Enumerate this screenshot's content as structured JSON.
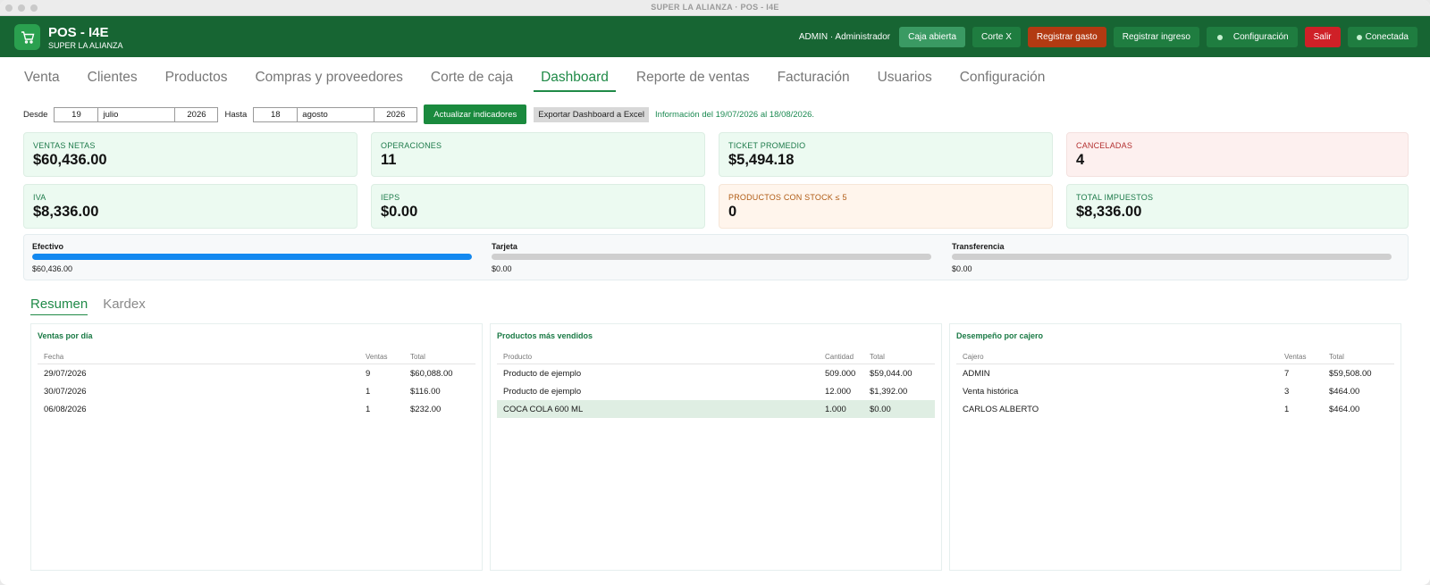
{
  "window": {
    "title": "SUPER LA ALIANZA · POS - I4E"
  },
  "header": {
    "app_title": "POS - I4E",
    "store_name": "SUPER LA ALIANZA",
    "user": "ADMIN · Administrador",
    "buttons": {
      "caja_abierta": "Caja abierta",
      "corte_x": "Corte X",
      "registrar_gasto": "Registrar gasto",
      "registrar_ingreso": "Registrar ingreso",
      "configuracion": "Configuración",
      "salir": "Salir",
      "conectada": "Conectada"
    }
  },
  "nav": {
    "tabs": [
      "Venta",
      "Clientes",
      "Productos",
      "Compras y proveedores",
      "Corte de caja",
      "Dashboard",
      "Reporte de ventas",
      "Facturación",
      "Usuarios",
      "Configuración"
    ],
    "active": "Dashboard"
  },
  "filters": {
    "desde_label": "Desde",
    "desde": {
      "day": "19",
      "month": "julio",
      "year": "2026"
    },
    "hasta_label": "Hasta",
    "hasta": {
      "day": "18",
      "month": "agosto",
      "year": "2026"
    },
    "update_button": "Actualizar indicadores",
    "export_button": "Exportar Dashboard a Excel",
    "info": "Información del 19/07/2026 al 18/08/2026."
  },
  "cards": [
    {
      "label": "VENTAS NETAS",
      "value": "$60,436.00"
    },
    {
      "label": "OPERACIONES",
      "value": "11"
    },
    {
      "label": "TICKET PROMEDIO",
      "value": "$5,494.18"
    },
    {
      "label": "CANCELADAS",
      "value": "4"
    },
    {
      "label": "IVA",
      "value": "$8,336.00"
    },
    {
      "label": "IEPS",
      "value": "$0.00"
    },
    {
      "label": "PRODUCTOS CON STOCK ≤ 5",
      "value": "0"
    },
    {
      "label": "TOTAL IMPUESTOS",
      "value": "$8,336.00"
    }
  ],
  "payments": [
    {
      "label": "Efectivo",
      "amount": "$60,436.00",
      "fraction": 1.0
    },
    {
      "label": "Tarjeta",
      "amount": "$0.00",
      "fraction": 0
    },
    {
      "label": "Transferencia",
      "amount": "$0.00",
      "fraction": 0
    }
  ],
  "subtabs": [
    "Resumen",
    "Kardex"
  ],
  "panels": {
    "ventas_por_dia": {
      "title": "Ventas por día",
      "headers": [
        "Fecha",
        "Ventas",
        "Total"
      ],
      "rows": [
        [
          "29/07/2026",
          "9",
          "$60,088.00"
        ],
        [
          "30/07/2026",
          "1",
          "$116.00"
        ],
        [
          "06/08/2026",
          "1",
          "$232.00"
        ]
      ]
    },
    "productos_mas_vendidos": {
      "title": "Productos más vendidos",
      "headers": [
        "Producto",
        "Cantidad",
        "Total"
      ],
      "rows": [
        [
          "Producto de ejemplo",
          "509.000",
          "$59,044.00"
        ],
        [
          "Producto de ejemplo",
          "12.000",
          "$1,392.00"
        ],
        [
          "COCA COLA 600 ML",
          "1.000",
          "$0.00"
        ]
      ]
    },
    "desempeno_por_cajero": {
      "title": "Desempeño por cajero",
      "headers": [
        "Cajero",
        "Ventas",
        "Total"
      ],
      "rows": [
        [
          "ADMIN",
          "7",
          "$59,508.00"
        ],
        [
          "Venta histórica",
          "3",
          "$464.00"
        ],
        [
          "CARLOS ALBERTO",
          "1",
          "$464.00"
        ]
      ]
    }
  }
}
